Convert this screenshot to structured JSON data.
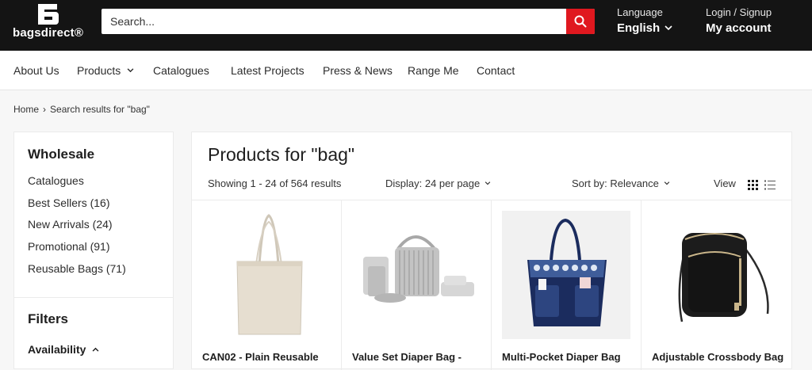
{
  "header": {
    "logo_text": "bagsdirect®",
    "search_placeholder": "Search...",
    "language_label": "Language",
    "language_value": "English",
    "account_label": "Login / Signup",
    "account_value": "My account"
  },
  "nav": {
    "items": [
      {
        "label": "About Us"
      },
      {
        "label": "Products"
      },
      {
        "label": "Catalogues"
      },
      {
        "label": "Latest Projects"
      },
      {
        "label": "Press & News"
      },
      {
        "label": "Range Me"
      },
      {
        "label": "Contact"
      }
    ]
  },
  "breadcrumb": {
    "home": "Home",
    "separator": "›",
    "current": "Search results for \"bag\""
  },
  "sidebar": {
    "title": "Wholesale",
    "items": [
      {
        "label": "Catalogues"
      },
      {
        "label": "Best Sellers (16)"
      },
      {
        "label": "New Arrivals (24)"
      },
      {
        "label": "Promotional (91)"
      },
      {
        "label": "Reusable Bags (71)"
      }
    ],
    "filters_title": "Filters",
    "availability_label": "Availability"
  },
  "main": {
    "title": "Products for \"bag\"",
    "showing": "Showing 1 - 24 of 564 results",
    "display": "Display: 24 per page",
    "sort": "Sort by: Relevance",
    "view_label": "View"
  },
  "products": [
    {
      "title": "CAN02 - Plain Reusable"
    },
    {
      "title": "Value Set Diaper Bag -"
    },
    {
      "title": "Multi-Pocket Diaper Bag"
    },
    {
      "title": "Adjustable Crossbody Bag"
    }
  ],
  "colors": {
    "header_bg": "#141414",
    "search_button": "#e0181f",
    "page_bg": "#f7f7f7"
  }
}
